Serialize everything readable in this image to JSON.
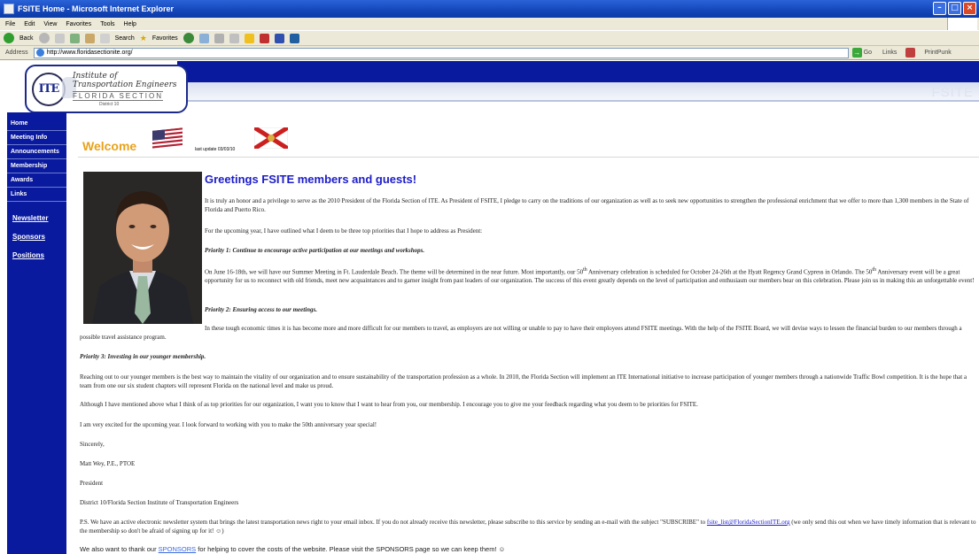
{
  "browser": {
    "title": "FSITE Home - Microsoft Internet Explorer",
    "menu": [
      "File",
      "Edit",
      "View",
      "Favorites",
      "Tools",
      "Help"
    ],
    "toolbar": {
      "back": "Back",
      "search": "Search",
      "favorites": "Favorites"
    },
    "address_label": "Address",
    "address_url": "http://www.floridasectionite.org/",
    "go_label": "Go",
    "links_label": "Links",
    "printpunk_label": "PrintPunk"
  },
  "logo": {
    "monogram": "ITE",
    "line1": "Institute of",
    "line2": "Transportation Engineers",
    "line3": "FLORIDA SECTION",
    "line4": "District 10"
  },
  "header": {
    "watermark": "FSITE"
  },
  "sidebar": {
    "items": [
      {
        "label": "Home"
      },
      {
        "label": "Meeting Info"
      },
      {
        "label": "Announcements"
      },
      {
        "label": "Membership"
      },
      {
        "label": "Awards"
      },
      {
        "label": "Links"
      }
    ],
    "links": [
      {
        "label": "Newsletter"
      },
      {
        "label": "Sponsors"
      },
      {
        "label": "Positions"
      }
    ]
  },
  "welcome": {
    "title": "Welcome",
    "last_update": "last update 03/03/10"
  },
  "content": {
    "heading": "Greetings FSITE members and guests!",
    "p1": "It is truly an honor and a privilege to serve as the 2010 President of the Florida Section of ITE. As President of FSITE, I pledge to carry on the traditions of our organization as well as to seek new opportunities to strengthen the professional enrichment that we offer to more than 1,300 members in the State of Florida and Puerto Rico.",
    "p2": "For the upcoming year, I have outlined what I deem to be three top priorities that I hope to address as President:",
    "priority1": "Priority 1: Continue to encourage active participation at our meetings and workshops.",
    "p3a": "On June 16-18th, we will have our Summer Meeting in Ft. Lauderdale Beach. The theme will be determined in the near future.  Most importantly, our 50",
    "p3b": " Anniversary celebration is scheduled for October 24-26th at the Hyatt Regency Grand Cypress in Orlando.  The 50",
    "p3c": " Anniversary event will be a great opportunity for us to reconnect with old friends, meet new acquaintances and to garner insight from past leaders of our organization. The success of this event greatly depends on the level of participation and enthusiasm our members bear on this celebration.  Please join us in making this an unforgettable event!",
    "th": "th",
    "priority2": "Priority 2:  Ensuring access to our meetings.",
    "p4": "In these tough economic times it is has become more and more difficult for our members to travel, as employers are not willing or unable to pay to have their employees attend FSITE meetings.  With the help of the FSITE Board, we will devise ways to lessen the financial burden to our members through a possible travel assistance program.",
    "priority3": "Priority 3: Investing in our younger membership.",
    "p5": "Reaching out to our younger members is the best way to maintain the vitality of our organization and to ensure sustainability of the transportation profession as a whole.  In 2010, the Florida Section will implement an ITE International initiative to increase participation of younger members through a nationwide Traffic Bowl competition.  It is the hope that a team from one our six student chapters will represent Florida on the national level and make us proud.",
    "p6": "Although I have mentioned above what I think of as top priorities for our organization, I want you to know that I want to hear from you, our membership. I encourage you to give me your feedback regarding what you deem to be priorities for FSITE.",
    "p7": "I am very excited for the upcoming year.  I look forward to working with you to make the 50th anniversary year special!",
    "sincerely": "Sincerely,",
    "signature_name": "Matt Wey, P.E., PTOE",
    "signature_title": "President",
    "signature_org": "District 10/Florida Section Institute of Transportation Engineers",
    "ps_a": "P.S. We have an active electronic newsletter system that brings the latest transportation news right to your email inbox.  If you do not already receive this newsletter, please subscribe to this service by sending an e-mail with the subject \"SUBSCRIBE\" to ",
    "ps_email": "fsite_list@FloridaSectionITE.org",
    "ps_b": " (we only send this out when we have timely information that is relevant to the membership so don't be afraid of signing up for it! ☺)",
    "thanks_a": "We also want to thank our ",
    "thanks_link": "SPONSORS",
    "thanks_b": " for helping to cover the costs of the website. Please visit the SPONSORS page so we can keep them! ☺"
  }
}
